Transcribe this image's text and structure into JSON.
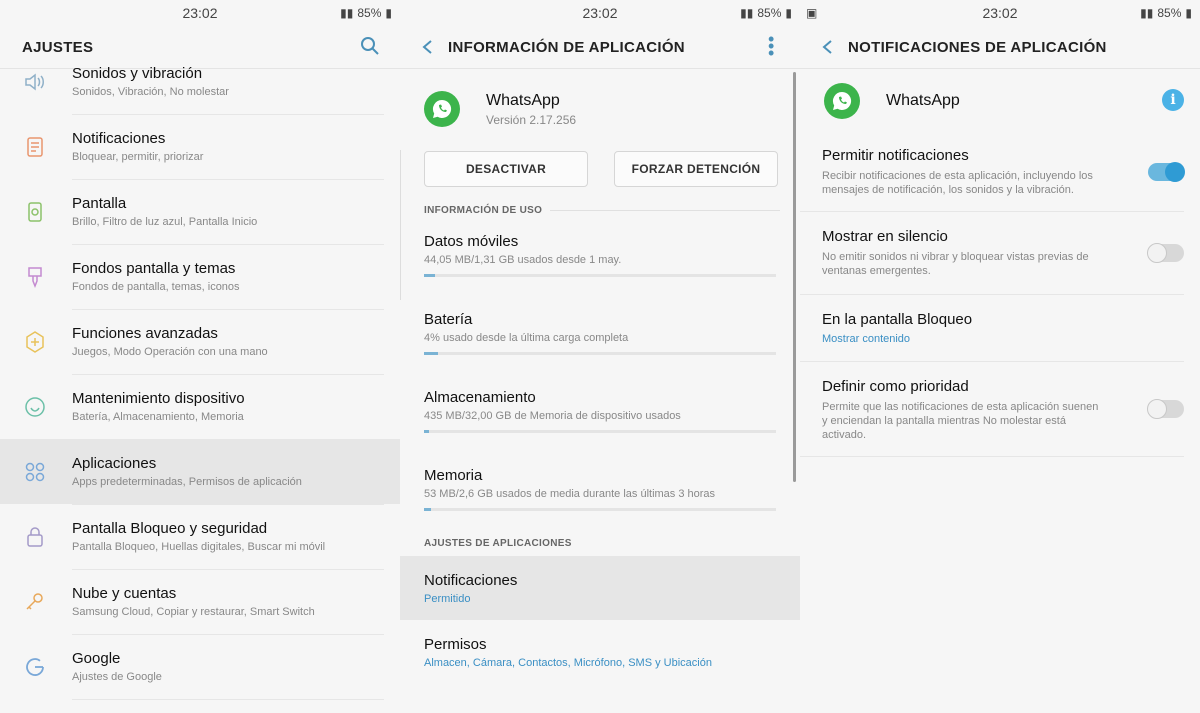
{
  "status": {
    "time": "23:02",
    "battery": "85%"
  },
  "screen1": {
    "title": "AJUSTES",
    "items": [
      {
        "label": "Sonidos y vibración",
        "sub": "Sonidos, Vibración, No molestar"
      },
      {
        "label": "Notificaciones",
        "sub": "Bloquear, permitir, priorizar"
      },
      {
        "label": "Pantalla",
        "sub": "Brillo, Filtro de luz azul, Pantalla Inicio"
      },
      {
        "label": "Fondos pantalla y temas",
        "sub": "Fondos de pantalla, temas, iconos"
      },
      {
        "label": "Funciones avanzadas",
        "sub": "Juegos, Modo Operación con una mano"
      },
      {
        "label": "Mantenimiento dispositivo",
        "sub": "Batería, Almacenamiento, Memoria"
      },
      {
        "label": "Aplicaciones",
        "sub": "Apps predeterminadas, Permisos de aplicación"
      },
      {
        "label": "Pantalla Bloqueo y seguridad",
        "sub": "Pantalla Bloqueo, Huellas digitales, Buscar mi móvil"
      },
      {
        "label": "Nube y cuentas",
        "sub": "Samsung Cloud, Copiar y restaurar, Smart Switch"
      },
      {
        "label": "Google",
        "sub": "Ajustes de Google"
      }
    ]
  },
  "screen2": {
    "title": "INFORMACIÓN DE APLICACIÓN",
    "app_name": "WhatsApp",
    "version": "Versión 2.17.256",
    "btn_disable": "DESACTIVAR",
    "btn_force": "FORZAR DETENCIÓN",
    "usage_header": "INFORMACIÓN DE USO",
    "usage": [
      {
        "label": "Datos móviles",
        "sub": "44,05 MB/1,31 GB usados desde 1 may.",
        "fill": 0.03
      },
      {
        "label": "Batería",
        "sub": "4% usado desde la última carga completa",
        "fill": 0.04
      },
      {
        "label": "Almacenamiento",
        "sub": "435 MB/32,00 GB de Memoria de dispositivo usados",
        "fill": 0.013
      },
      {
        "label": "Memoria",
        "sub": "53 MB/2,6 GB usados de media durante las últimas 3 horas",
        "fill": 0.02
      }
    ],
    "settings_header": "AJUSTES DE APLICACIONES",
    "notif_label": "Notificaciones",
    "notif_sub": "Permitido",
    "perm_label": "Permisos",
    "perm_sub": "Almacen, Cámara, Contactos, Micrófono, SMS y Ubicación"
  },
  "screen3": {
    "title": "NOTIFICACIONES DE APLICACIÓN",
    "app_name": "WhatsApp",
    "items": [
      {
        "label": "Permitir notificaciones",
        "sub": "Recibir notificaciones de esta aplicación, incluyendo los mensajes de notificación, los sonidos y la vibración.",
        "on": true
      },
      {
        "label": "Mostrar en silencio",
        "sub": "No emitir sonidos ni vibrar y bloquear vistas previas de ventanas emergentes.",
        "on": false
      },
      {
        "label": "En la pantalla Bloqueo",
        "link": "Mostrar contenido"
      },
      {
        "label": "Definir como prioridad",
        "sub": "Permite que las notificaciones de esta aplicación suenen y enciendan la pantalla mientras No molestar está activado.",
        "on": false
      }
    ]
  }
}
